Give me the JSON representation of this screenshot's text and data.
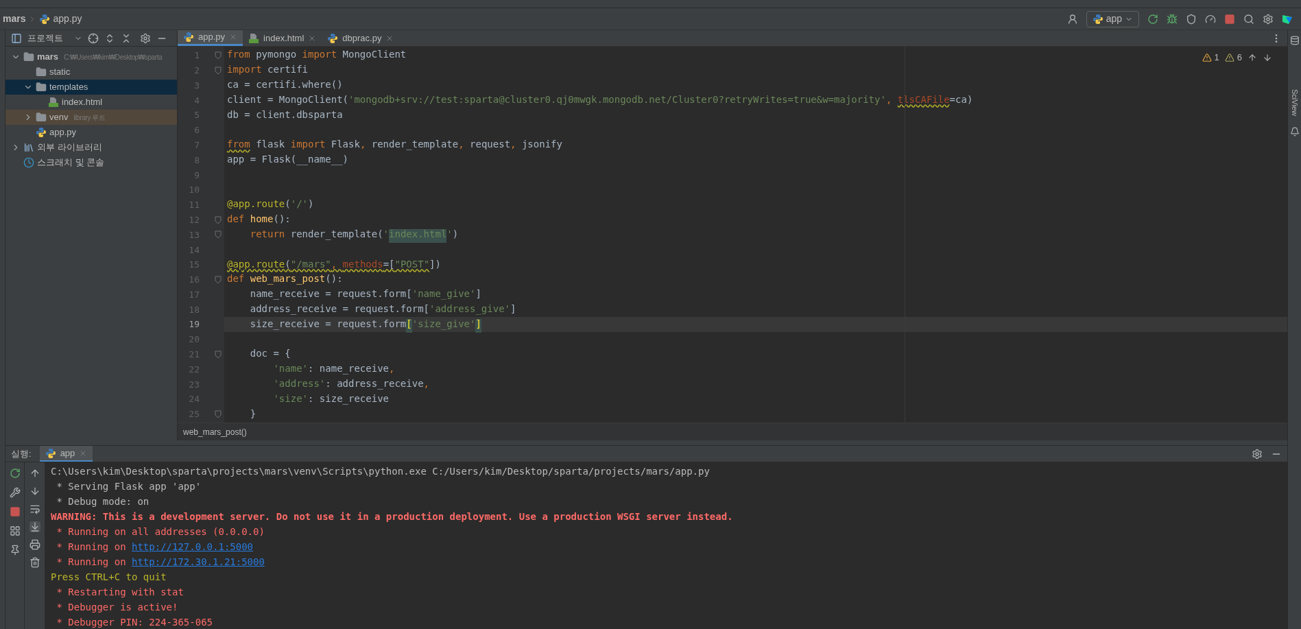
{
  "breadcrumb": [
    {
      "label": "mars",
      "kind": "folder"
    },
    {
      "label": "app.py",
      "kind": "python"
    }
  ],
  "toolbar": {
    "run_config": "app"
  },
  "project_panel": {
    "title": "프로젝트",
    "tree": [
      {
        "label": "mars",
        "hint": "C:₩Users₩kim₩Desktop₩sparta",
        "kind": "folder",
        "expanded": true,
        "selected": false,
        "highlighted": false,
        "children": [
          {
            "label": "static",
            "kind": "folder",
            "selected": false,
            "highlighted": false
          },
          {
            "label": "templates",
            "kind": "folder",
            "expanded": true,
            "selected": true,
            "highlighted": false,
            "children": [
              {
                "label": "index.html",
                "kind": "html",
                "selected": false,
                "highlighted": false
              }
            ]
          },
          {
            "label": "venv",
            "hint": "library 루트",
            "kind": "folder",
            "expanded": false,
            "selected": false,
            "highlighted": true
          },
          {
            "label": "app.py",
            "kind": "python",
            "selected": false,
            "highlighted": false
          }
        ]
      },
      {
        "label": "외부 라이브러리",
        "kind": "library",
        "expanded": false,
        "selected": false,
        "highlighted": false
      },
      {
        "label": "스크래치 및 콘솔",
        "kind": "scratch",
        "selected": false,
        "highlighted": false
      }
    ]
  },
  "editor_tabs": [
    {
      "label": "app.py",
      "kind": "python",
      "selected": true
    },
    {
      "label": "index.html",
      "kind": "html",
      "selected": false
    },
    {
      "label": "dbprac.py",
      "kind": "python",
      "selected": false
    }
  ],
  "inspections": {
    "warnings": "1",
    "weak_warnings": "6"
  },
  "code_lines": [
    {
      "number": "1",
      "fold": true,
      "current": false,
      "tokens": [
        {
          "kind": "keyword",
          "text": "from"
        },
        {
          "kind": "name",
          "text": " pymongo "
        },
        {
          "kind": "keyword",
          "text": "import"
        },
        {
          "kind": "name",
          "text": " MongoClient"
        }
      ]
    },
    {
      "number": "2",
      "fold": true,
      "current": false,
      "tokens": [
        {
          "kind": "keyword",
          "text": "import"
        },
        {
          "kind": "name",
          "text": " certifi"
        }
      ]
    },
    {
      "number": "3",
      "fold": false,
      "current": false,
      "tokens": [
        {
          "kind": "name",
          "text": "ca = certifi.where()"
        }
      ]
    },
    {
      "number": "4",
      "fold": false,
      "current": false,
      "tokens": [
        {
          "kind": "name",
          "text": "client = MongoClient("
        },
        {
          "kind": "string",
          "text": "'mongodb+srv://test:sparta@cluster0.qj0mwgk.mongodb.net/Cluster0?retryWrites=true&w=majority'"
        },
        {
          "kind": "keyword",
          "text": ", "
        },
        {
          "kind": "param",
          "text": "tlsCAFile",
          "warning": true
        },
        {
          "kind": "name",
          "text": "=ca)"
        }
      ]
    },
    {
      "number": "5",
      "fold": false,
      "current": false,
      "tokens": [
        {
          "kind": "name",
          "text": "db = client.dbsparta"
        }
      ]
    },
    {
      "number": "6",
      "fold": false,
      "current": false
    },
    {
      "number": "7",
      "fold": false,
      "current": false,
      "tokens": [
        {
          "kind": "keyword",
          "text": "from",
          "warning": true
        },
        {
          "kind": "name",
          "text": " flask "
        },
        {
          "kind": "keyword",
          "text": "import"
        },
        {
          "kind": "name",
          "text": " Flask"
        },
        {
          "kind": "keyword",
          "text": ","
        },
        {
          "kind": "name",
          "text": " render_template"
        },
        {
          "kind": "keyword",
          "text": ","
        },
        {
          "kind": "name",
          "text": " request"
        },
        {
          "kind": "keyword",
          "text": ","
        },
        {
          "kind": "name",
          "text": " jsonify"
        }
      ]
    },
    {
      "number": "8",
      "fold": false,
      "current": false,
      "tokens": [
        {
          "kind": "name",
          "text": "app = Flask(__name__)"
        }
      ]
    },
    {
      "number": "9",
      "fold": false,
      "current": false
    },
    {
      "number": "10",
      "fold": false,
      "current": false
    },
    {
      "number": "11",
      "fold": false,
      "current": false,
      "tokens": [
        {
          "kind": "decorator",
          "text": "@app.route"
        },
        {
          "kind": "name",
          "text": "("
        },
        {
          "kind": "string",
          "text": "'/'"
        },
        {
          "kind": "name",
          "text": ")"
        }
      ]
    },
    {
      "number": "12",
      "fold": true,
      "current": false,
      "tokens": [
        {
          "kind": "keyword",
          "text": "def"
        },
        {
          "kind": "function",
          "text": " home"
        },
        {
          "kind": "name",
          "text": "():"
        }
      ]
    },
    {
      "number": "13",
      "fold": true,
      "current": false,
      "tokens": [
        {
          "kind": "keyword",
          "text": "    return"
        },
        {
          "kind": "name",
          "text": " render_template("
        },
        {
          "kind": "string",
          "text": "'"
        },
        {
          "kind": "string",
          "text": "index.html",
          "highlighted": true
        },
        {
          "kind": "string",
          "text": "'"
        },
        {
          "kind": "name",
          "text": ")"
        }
      ]
    },
    {
      "number": "14",
      "fold": false,
      "current": false
    },
    {
      "number": "15",
      "fold": false,
      "current": false,
      "tokens": [
        {
          "kind": "decorator",
          "text": "@app.route",
          "warning": true
        },
        {
          "kind": "name",
          "text": "(",
          "warning": true
        },
        {
          "kind": "string",
          "text": "\"/mars\"",
          "warning": true
        },
        {
          "kind": "keyword",
          "text": ", ",
          "warning": true
        },
        {
          "kind": "param",
          "text": "methods",
          "warning": true
        },
        {
          "kind": "name",
          "text": "=[",
          "warning": true
        },
        {
          "kind": "string",
          "text": "\"POST\"",
          "warning": true
        },
        {
          "kind": "name",
          "text": "])"
        }
      ]
    },
    {
      "number": "16",
      "fold": true,
      "current": false,
      "tokens": [
        {
          "kind": "keyword",
          "text": "def"
        },
        {
          "kind": "function",
          "text": " web_mars_post"
        },
        {
          "kind": "name",
          "text": "():"
        }
      ]
    },
    {
      "number": "17",
      "fold": false,
      "current": false,
      "tokens": [
        {
          "kind": "name",
          "text": "    name_receive = request.form["
        },
        {
          "kind": "string",
          "text": "'name_give'"
        },
        {
          "kind": "name",
          "text": "]"
        }
      ]
    },
    {
      "number": "18",
      "fold": false,
      "current": false,
      "tokens": [
        {
          "kind": "name",
          "text": "    address_receive = request.form["
        },
        {
          "kind": "string",
          "text": "'address_give'"
        },
        {
          "kind": "name",
          "text": "]"
        }
      ]
    },
    {
      "number": "19",
      "fold": false,
      "current": true,
      "tokens": [
        {
          "kind": "name",
          "text": "    size_receive = request.form"
        },
        {
          "kind": "name",
          "text": "[",
          "matched": true
        },
        {
          "kind": "string",
          "text": "'size_give'"
        },
        {
          "kind": "name",
          "text": "]",
          "matched": true
        }
      ]
    },
    {
      "number": "20",
      "fold": false,
      "current": false
    },
    {
      "number": "21",
      "fold": true,
      "current": false,
      "tokens": [
        {
          "kind": "name",
          "text": "    doc = {"
        }
      ]
    },
    {
      "number": "22",
      "fold": false,
      "current": false,
      "tokens": [
        {
          "kind": "string",
          "text": "        'name'"
        },
        {
          "kind": "name",
          "text": ": name_receive"
        },
        {
          "kind": "keyword",
          "text": ","
        }
      ]
    },
    {
      "number": "23",
      "fold": false,
      "current": false,
      "tokens": [
        {
          "kind": "string",
          "text": "        'address'"
        },
        {
          "kind": "name",
          "text": ": address_receive"
        },
        {
          "kind": "keyword",
          "text": ","
        }
      ]
    },
    {
      "number": "24",
      "fold": false,
      "current": false,
      "tokens": [
        {
          "kind": "string",
          "text": "        'size'"
        },
        {
          "kind": "name",
          "text": ": size_receive"
        }
      ]
    },
    {
      "number": "25",
      "fold": true,
      "current": false,
      "tokens": [
        {
          "kind": "name",
          "text": "    }"
        }
      ]
    }
  ],
  "editor_breadcrumb": "web_mars_post()",
  "run_panel": {
    "label": "실행:",
    "tabs": [
      {
        "label": "app",
        "selected": true
      }
    ],
    "console_lines": [
      [
        {
          "kind": "plain",
          "text": "C:\\Users\\kim\\Desktop\\sparta\\projects\\mars\\venv\\Scripts\\python.exe C:/Users/kim/Desktop/sparta/projects/mars/app.py"
        }
      ],
      [
        {
          "kind": "plain",
          "text": " * Serving Flask app 'app'"
        }
      ],
      [
        {
          "kind": "plain",
          "text": " * Debug mode: on"
        }
      ],
      [
        {
          "kind": "error",
          "text": "WARNING: This is a development server. Do not use it in a production deployment. Use a production WSGI server instead."
        }
      ],
      [
        {
          "kind": "red",
          "text": " * Running on all addresses (0.0.0.0)"
        }
      ],
      [
        {
          "kind": "red",
          "text": " * Running on "
        },
        {
          "kind": "link",
          "text": "http://127.0.0.1:5000"
        }
      ],
      [
        {
          "kind": "red",
          "text": " * Running on "
        },
        {
          "kind": "link",
          "text": "http://172.30.1.21:5000"
        }
      ],
      [
        {
          "kind": "yellow",
          "text": "Press CTRL+C to quit"
        }
      ],
      [
        {
          "kind": "red",
          "text": " * Restarting with stat"
        }
      ],
      [
        {
          "kind": "red",
          "text": " * Debugger is active!"
        }
      ],
      [
        {
          "kind": "red",
          "text": " * Debugger PIN: 224-365-065"
        }
      ]
    ]
  },
  "right_sidebar": {
    "label": "SciView"
  }
}
